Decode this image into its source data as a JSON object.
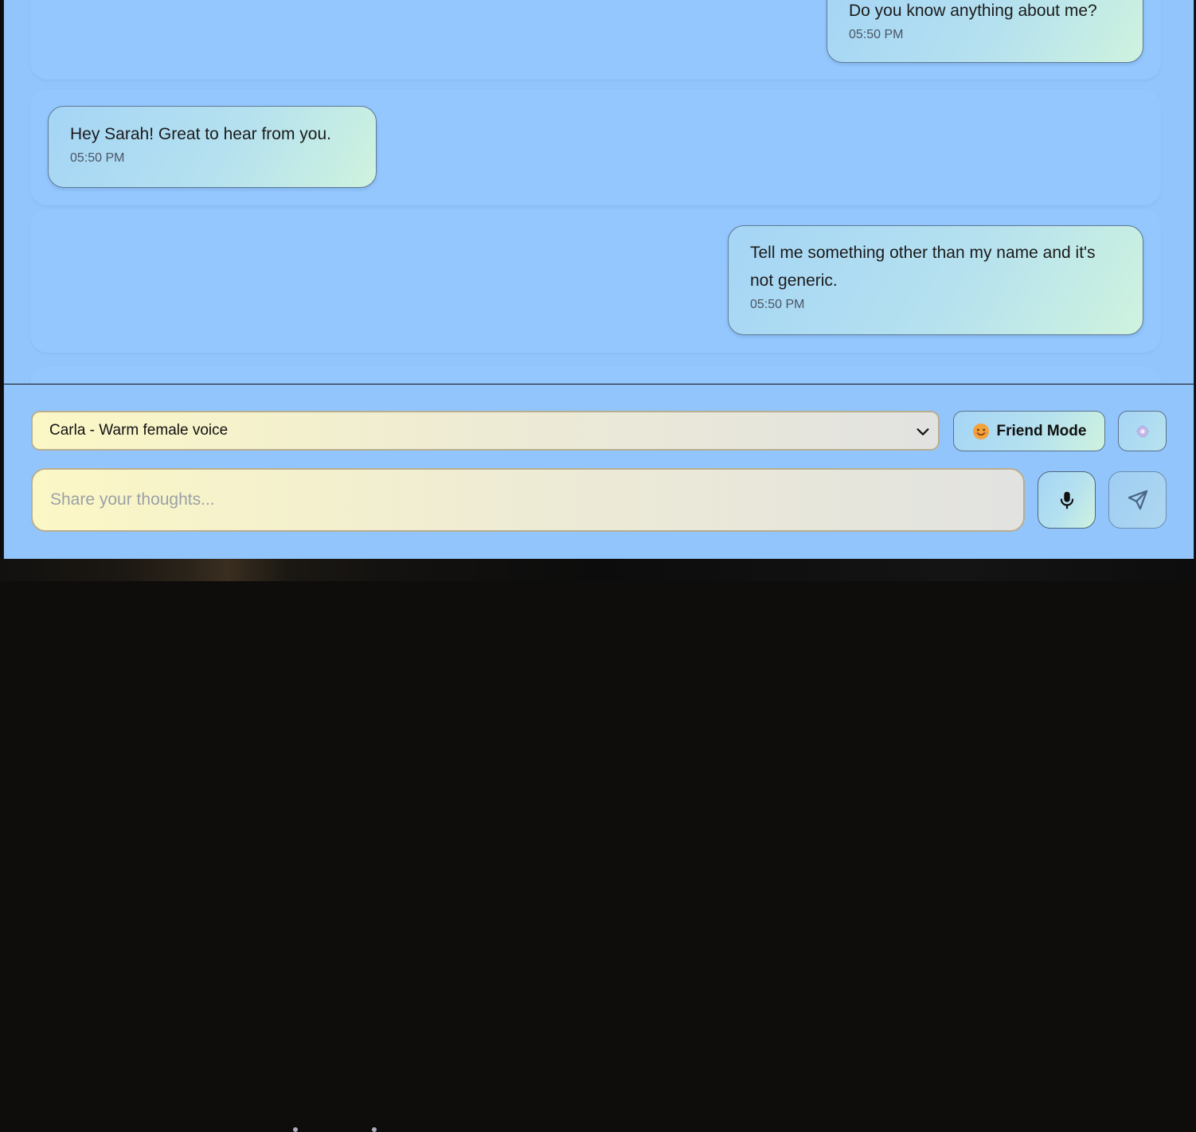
{
  "messages": [
    {
      "text": "Do you know anything about me?",
      "time": "05:50 PM",
      "sender": "user"
    },
    {
      "text": "Hey Sarah! Great to hear from you.",
      "time": "05:50 PM",
      "sender": "assistant"
    },
    {
      "text": "Tell me something other than my name and it's not generic.",
      "time": "05:50 PM",
      "sender": "user"
    }
  ],
  "controls": {
    "voice_selected": "Carla - Warm female voice",
    "mode_label": "Friend Mode",
    "mode_icon": "smiling-face-emoji",
    "settings_icon": "gear-icon"
  },
  "composer": {
    "placeholder": "Share your thoughts..."
  },
  "colors": {
    "app_bg": "#93c5fd",
    "bubble_border": "#5f7a94",
    "input_border": "#b8ae90"
  }
}
